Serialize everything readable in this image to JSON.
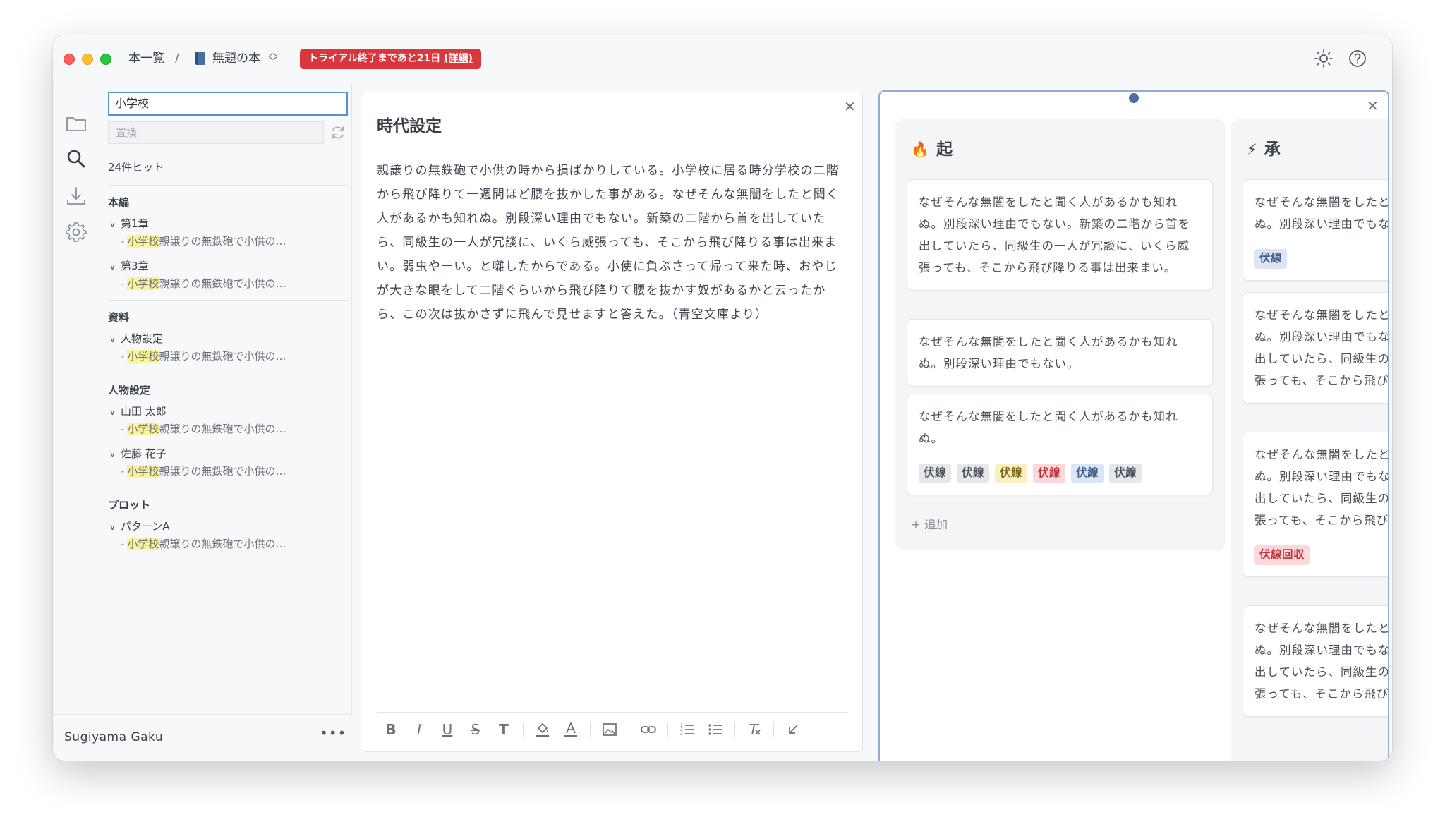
{
  "titlebar": {
    "breadcrumb_home": "本一覧",
    "breadcrumb_sep": "/",
    "book_title": "無題の本",
    "trial_badge": "トライアル終了まであと21日",
    "trial_detail": "(詳細)"
  },
  "user": {
    "name": "Sugiyama Gaku",
    "more": "•••"
  },
  "search": {
    "query": "小学校",
    "replace_placeholder": "置換",
    "hit_count": "24件ヒット",
    "groups": [
      {
        "title": "本編",
        "files": [
          {
            "name": "第1章",
            "match_hl": "小学校",
            "match_rest": "親譲りの無鉄砲で小供の…"
          },
          {
            "name": "第3章",
            "match_hl": "小学校",
            "match_rest": "親譲りの無鉄砲で小供の…"
          }
        ]
      },
      {
        "title": "資料",
        "files": [
          {
            "name": "人物設定",
            "match_hl": "小学校",
            "match_rest": "親譲りの無鉄砲で小供の…"
          }
        ]
      },
      {
        "title": "人物設定",
        "files": [
          {
            "name": "山田 太郎",
            "match_hl": "小学校",
            "match_rest": "親譲りの無鉄砲で小供の…"
          },
          {
            "name": "佐藤 花子",
            "match_hl": "小学校",
            "match_rest": "親譲りの無鉄砲で小供の…"
          }
        ]
      },
      {
        "title": "プロット",
        "files": [
          {
            "name": "パターンA",
            "match_hl": "小学校",
            "match_rest": "親譲りの無鉄砲で小供の…"
          }
        ]
      }
    ]
  },
  "editor": {
    "title": "時代設定",
    "body": "親譲りの無鉄砲で小供の時から損ばかりしている。小学校に居る時分学校の二階から飛び降りて一週間ほど腰を抜かした事がある。なぜそんな無闇をしたと聞く人があるかも知れぬ。別段深い理由でもない。新築の二階から首を出していたら、同級生の一人が冗談に、いくら威張っても、そこから飛び降りる事は出来まい。弱虫やーい。と囃したからである。小使に負ぶさって帰って来た時、おやじが大きな眼をして二階ぐらいから飛び降りて腰を抜かす奴があるかと云ったから、この次は抜かさずに飛んで見せますと答えた。（青空文庫より）"
  },
  "board": {
    "add_label": "+ 追加",
    "columns": [
      {
        "emoji": "🔥",
        "title": "起",
        "cards": [
          {
            "text": "なぜそんな無闇をしたと聞く人があるかも知れぬ。別段深い理由でもない。新築の二階から首を出していたら、同級生の一人が冗談に、いくら威張っても、そこから飛び降りる事は出来まい。",
            "tags": []
          },
          {
            "text": "なぜそんな無闇をしたと聞く人があるかも知れぬ。別段深い理由でもない。",
            "tags": []
          },
          {
            "text": "なぜそんな無闇をしたと聞く人があるかも知れぬ。",
            "tags": [
              "伏線",
              "伏線",
              "伏線",
              "伏線",
              "伏線",
              "伏線"
            ]
          }
        ]
      },
      {
        "emoji": "⚡",
        "title": "承",
        "cards": [
          {
            "text": "なぜそんな無闇をしたと聞く人があるかも知れぬ。別段深い理由でもない。",
            "tags": [
              "伏線"
            ]
          },
          {
            "text": "なぜそんな無闇をしたと聞く人があるかも知れぬ。別段深い理由でもない。新築の二階から首を出していたら、同級生の一人が冗談に、いくら威張っても、そこから飛び降りる事は出来まい。",
            "tags": []
          },
          {
            "text": "なぜそんな無闇をしたと聞く人があるかも知れぬ。別段深い理由でもない。新築の二階から首を出していたら、同級生の一人が冗談に、いくら威張っても、そこから飛び降りる事は出来まい。",
            "tags": [
              "伏線回収"
            ]
          },
          {
            "text": "なぜそんな無闇をしたと聞く人があるかも知れぬ。別段深い理由でもない。新築の二階から首を出していたら、同級生の一人が冗談に、いくら威張っても、そこから飛び降りる事は出来まい。",
            "tags": []
          }
        ]
      }
    ]
  },
  "colors": {
    "trial_badge": "#d9363e",
    "highlight": "#fbf39a",
    "accent": "#4a6fa5",
    "tag_gray": "#e5e7ea",
    "tag_yellow": "#faf0c2",
    "tag_red": "#fbd9db",
    "tag_blue": "#dbe5f3"
  },
  "icons": {
    "activity": [
      "folder-icon",
      "search-icon",
      "download-icon",
      "gear-icon"
    ],
    "titlebar": [
      "sun-icon",
      "help-icon"
    ],
    "toolbar": [
      "bold-icon",
      "italic-icon",
      "underline-icon",
      "strikethrough-icon",
      "text-style-icon",
      "fill-color-icon",
      "font-color-icon",
      "image-icon",
      "link-icon",
      "ordered-list-icon",
      "bullet-list-icon",
      "clear-format-icon",
      "collapse-icon"
    ]
  }
}
